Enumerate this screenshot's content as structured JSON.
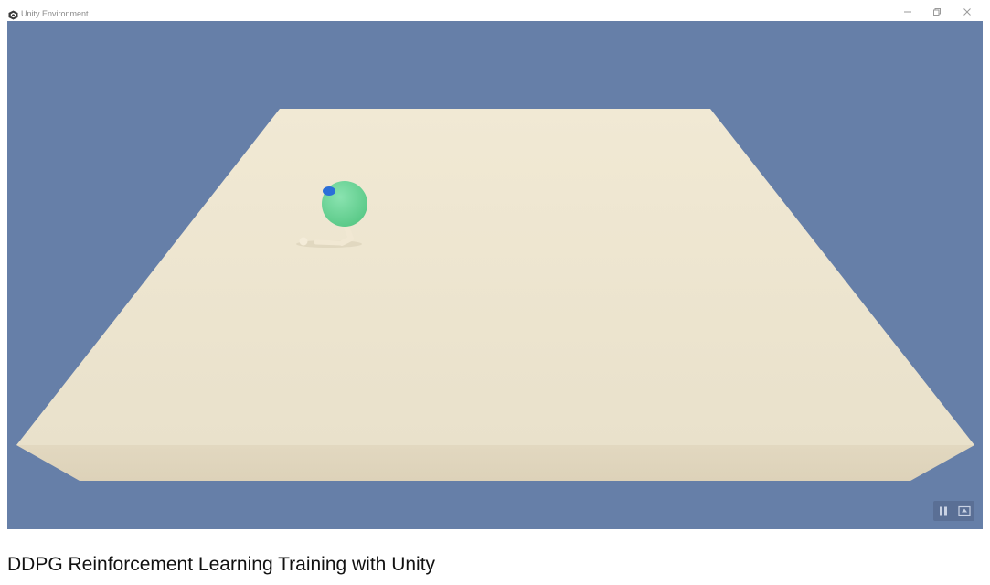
{
  "window": {
    "title": "Unity Environment",
    "app_icon": "unity-logo-icon",
    "controls": {
      "minimize_icon": "minimize-icon",
      "restore_icon": "restore-icon",
      "close_icon": "close-icon"
    }
  },
  "scene": {
    "background_color": "#667fa8",
    "platform_color": "#ece4cf",
    "agent_head_color": "#6ed498",
    "agent_eye_color": "#2b6fd8",
    "agent_limb_color": "#f1e8d3"
  },
  "overlay": {
    "pause_icon": "pause-icon",
    "fullscreen_icon": "fullscreen-icon"
  },
  "video": {
    "title": "DDPG Reinforcement Learning Training with Unity"
  }
}
